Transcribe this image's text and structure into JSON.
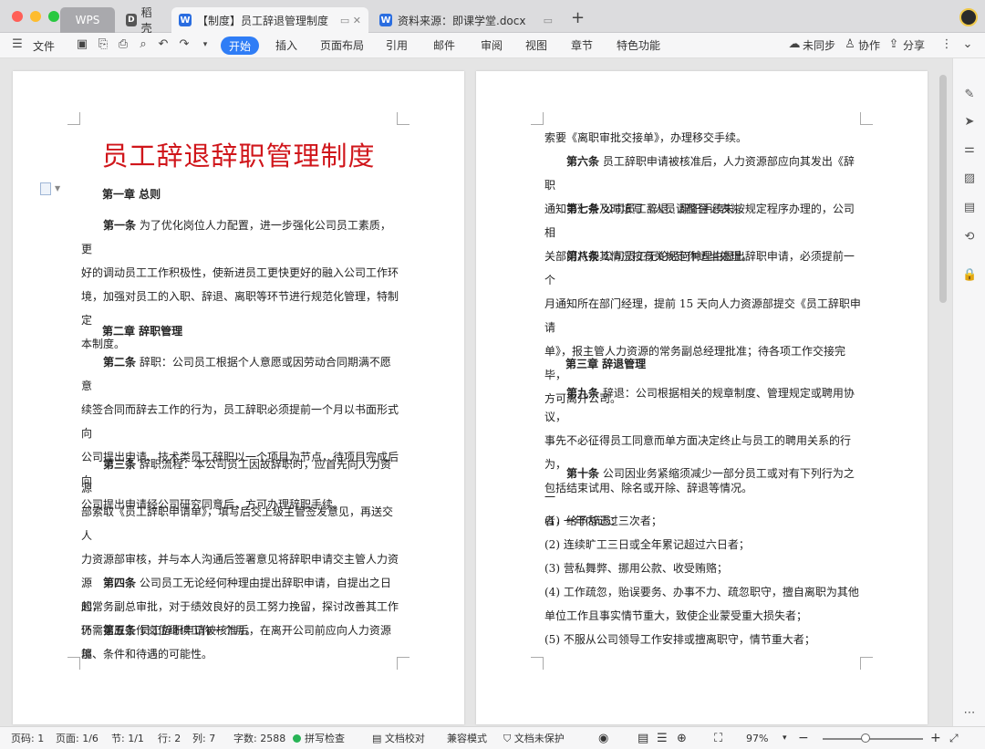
{
  "tabs": {
    "wps": "WPS",
    "daoke": "稻壳",
    "active": "【制度】员工辞退管理制度",
    "doc2": "资料来源：即课学堂.docx",
    "new_tab": "+"
  },
  "toolbar": {
    "file": "文件",
    "start": "开始",
    "menus": [
      "插入",
      "页面布局",
      "引用",
      "邮件",
      "审阅",
      "视图",
      "章节",
      "特色功能"
    ],
    "sync": "未同步",
    "collab": "协作",
    "share": "分享"
  },
  "document": {
    "title": "员工辞退辞职管理制度",
    "left": {
      "ch1": "第一章  总则",
      "a1_label": "第一条",
      "a1_lines": [
        "为了优化岗位人力配置，进一步强化公司员工素质，更",
        "好的调动员工工作积极性，使新进员工更快更好的融入公司工作环",
        "境，加强对员工的入职、辞退、离职等环节进行规范化管理，特制定",
        "本制度。"
      ],
      "ch2": "第二章  辞职管理",
      "a2_label": "第二条",
      "a2_lines": [
        "辞职：公司员工根据个人意愿或因劳动合同期满不愿意",
        "续签合同而辞去工作的行为，员工辞职必须提前一个月以书面形式向",
        "公司提出申请、技术类员工辞职以一个项目为节点，待项目完成后向",
        "公司提出申请经公司研究同意后，方可办理辞职手续。"
      ],
      "a3_label": "第三条",
      "a3_lines": [
        "辞职流程：本公司员工因故辞职时，应首先向人力资源",
        "部索取《员工辞职申请单》，填写后交上级主管签发意见，再送交人",
        "力资源部审核，并与本人沟通后签署意见将辞职申请交主管人力资源",
        "的常务副总审批，对于绩效良好的员工努力挽留，探讨改善其工作环",
        "境、条件和待遇的可能性。"
      ],
      "a4_label": "第四条",
      "a4_lines": [
        "公司员工无论经何种理由提出辞职申请，自提出之日起，",
        "仍需在原工作岗位继续工作一个月。"
      ],
      "a5_label": "第五条",
      "a5_lines": [
        "员工辞职申请被核准后，在离开公司前应向人力资源部"
      ]
    },
    "right": {
      "cont_lines": [
        "索要《离职审批交接单》，办理移交手续。"
      ],
      "a6_label": "第六条",
      "a6_lines": [
        "员工辞职申请被核准后，人力资源部应向其发出《辞职",
        "通知书》并及时填写《人员调整登记表》。"
      ],
      "a7_label": "第七条",
      "a7_lines": [
        "公司员工辞退、辞职手续未按规定程序办理的，公司相",
        "关部门将视其情况按有关规定作适当处理。"
      ],
      "a8_label": "第八条",
      "a8_lines": [
        "公司员工无论经何种理由提出辞职申请，必须提前一个",
        "月通知所在部门经理，提前 15 天向人力资源部提交《员工辞职申请",
        "单》，报主管人力资源的常务副总经理批准；待各项工作交接完毕，",
        "方可离开公司。"
      ],
      "ch3": "第三章  辞退管理",
      "a9_label": "第九条",
      "a9_lines": [
        "辞退：公司根据相关的规章制度、管理规定或聘用协议，",
        "事先不必征得员工同意而单方面决定终止与员工的聘用关系的行为，",
        "包括结束试用、除名或开除、辞退等情况。"
      ],
      "a10_label": "第十条",
      "a10_lines": [
        "公司因业务紧缩须减少一部分员工或对有下列行为之一",
        "者，给予辞退："
      ],
      "items": [
        "(1)    一年内记过三次者；",
        "(2)  连续旷工三日或全年累记超过六日者；",
        "(3)  营私舞弊、挪用公款、收受贿赂；",
        "(4)  工作疏忽，贻误要务、办事不力、疏忽职守，擅自离职为其他",
        "单位工作且事实情节重大，致使企业蒙受重大损失者；",
        "(5)    不服从公司领导工作安排或擅离职守，情节重大者；"
      ]
    }
  },
  "status": {
    "page_num": "页码: 1",
    "pages": "页面: 1/6",
    "section": "节: 1/1",
    "row": "行: 2",
    "col": "列: 7",
    "words": "字数: 2588",
    "spell": "拼写检查",
    "proof": "文档校对",
    "compat": "兼容模式",
    "protect": "文档未保护",
    "zoom": "97%"
  },
  "colors": {
    "accent": "#2f7df6",
    "title_red": "#d0161b"
  }
}
